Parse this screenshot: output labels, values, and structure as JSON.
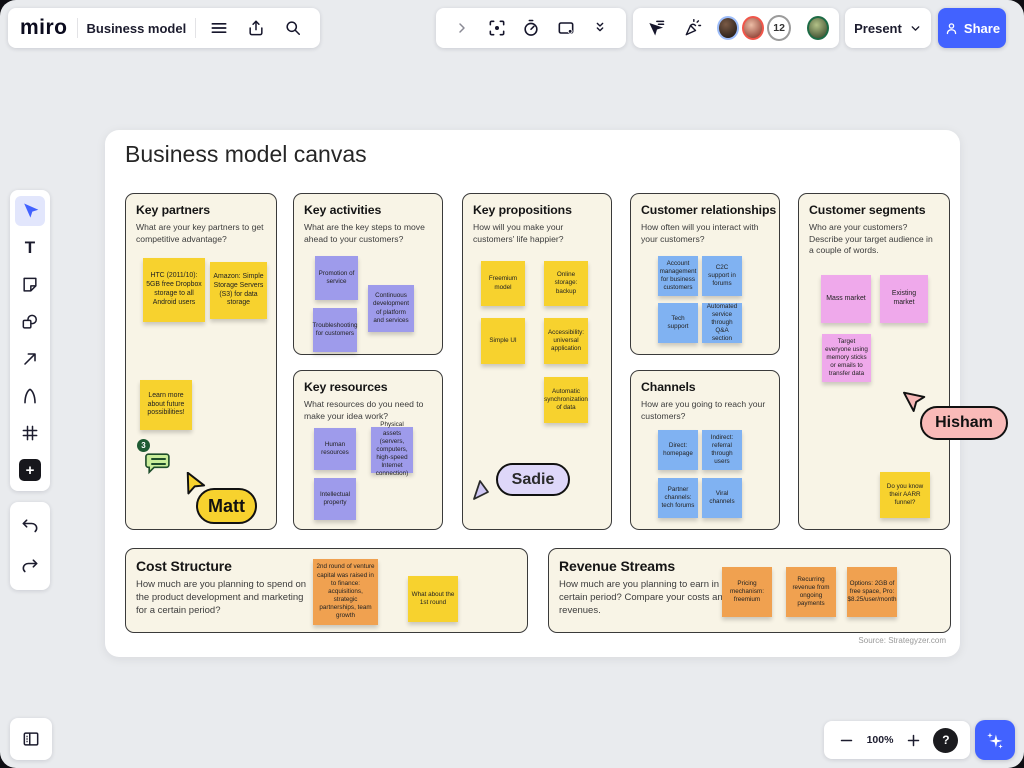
{
  "topbar": {
    "logo": "miro",
    "board_title": "Business model",
    "present_label": "Present",
    "share_label": "Share",
    "participants_count": "12"
  },
  "toolbar": {
    "text_tool_glyph": "T"
  },
  "controls": {
    "zoom_level": "100%",
    "help_label": "?"
  },
  "collaborators": {
    "matt": "Matt",
    "sadie": "Sadie",
    "hisham": "Hisham",
    "comment_count": "3"
  },
  "colors": {
    "accent": "#4262ff",
    "sticky_yellow": "#f7d22e",
    "sticky_purple": "#9e9beb",
    "sticky_blue": "#80b2f2",
    "sticky_pink": "#efa9eb",
    "sticky_orange": "#f0a150"
  },
  "canvas": {
    "title": "Business model canvas",
    "source": "Source: Strategyzer.com",
    "sections": {
      "key_partners": {
        "title": "Key partners",
        "description": "What are your key partners to get competitive advantage?",
        "notes": [
          "HTC (2011/10): 5GB free Dropbox storage to all Android users",
          "Amazon: Simple Storage Servers (S3) for data storage",
          "Learn more about future possibilities!"
        ]
      },
      "key_activities": {
        "title": "Key activities",
        "description": "What are the key steps to move ahead to your customers?",
        "notes": [
          "Promotion of service",
          "Continuous development of platform and services",
          "Troubleshooting for customers"
        ]
      },
      "key_resources": {
        "title": "Key resources",
        "description": "What resources do you need to make your idea work?",
        "notes": [
          "Human resources",
          "Physical assets (servers, computers, high-speed Internet connection)",
          "Intellectual property"
        ]
      },
      "key_propositions": {
        "title": "Key propositions",
        "description": "How will you make your customers' life happier?",
        "notes": [
          "Freemium model",
          "Online storage: backup",
          "Simple UI",
          "Accessibility: universal application",
          "Automatic synchronization of data"
        ]
      },
      "customer_relationships": {
        "title": "Customer relationships",
        "description": "How often will you interact with your customers?",
        "notes": [
          "Account management for business customers",
          "C2C support in forums",
          "Tech support",
          "Automated service through Q&A section"
        ]
      },
      "channels": {
        "title": "Channels",
        "description": "How are you going to reach your customers?",
        "notes": [
          "Direct: homepage",
          "Indirect: referral through users",
          "Partner channels: tech forums",
          "Viral channels"
        ]
      },
      "customer_segments": {
        "title": "Customer segments",
        "description": "Who are your customers? Describe your target audience in a couple of words.",
        "notes": [
          "Mass market",
          "Existing market",
          "Target everyone using memory sticks or emails to transfer data",
          "Do you know their AARR funnel?"
        ]
      },
      "cost_structure": {
        "title": "Cost Structure",
        "description": "How much are you planning to spend on the product development and marketing for a certain period?",
        "notes": [
          "2nd round of venture capital was raised in to finance: acquisitions, strategic partnerships, team growth",
          "What about the 1st round"
        ]
      },
      "revenue_streams": {
        "title": "Revenue Streams",
        "description": "How much are you planning to earn in a certain period? Compare your costs and revenues.",
        "notes": [
          "Pricing mechanism: freemium",
          "Recurring revenue from ongoing payments",
          "Options: 2GB of free space, Pro: $8.25/user/month"
        ]
      }
    }
  }
}
